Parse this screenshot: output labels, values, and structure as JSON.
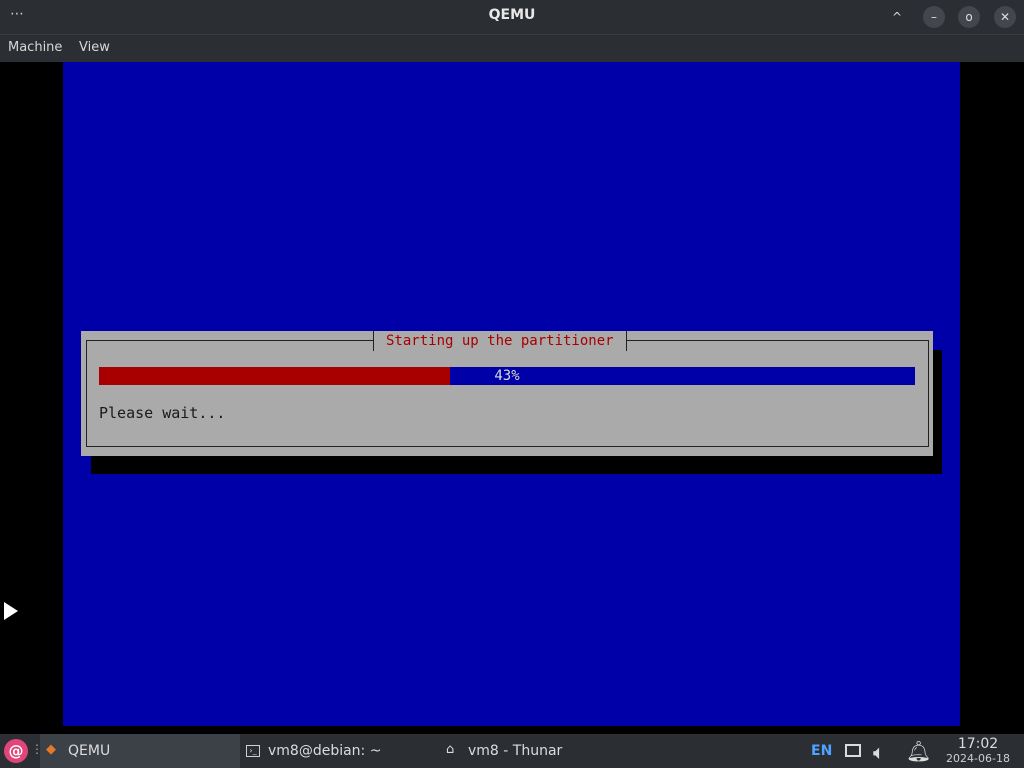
{
  "window": {
    "title": "QEMU",
    "controls": {
      "menu": "⋯",
      "restore_up": "^",
      "minimize": "–",
      "maximize": "o",
      "close": "✕"
    }
  },
  "menubar": {
    "items": [
      "Machine",
      "View"
    ]
  },
  "installer": {
    "dialog_title": "Starting up the partitioner",
    "progress": {
      "percent_value": 43,
      "label": "43%"
    },
    "message": "Please wait...",
    "colors": {
      "background": "#0000a8",
      "dialog": "#aaaaaa",
      "progress_fill": "#a80000",
      "title_text": "#a80000"
    }
  },
  "taskbar": {
    "start_icon": "debian-swirl-icon",
    "tasks": [
      {
        "label": "QEMU",
        "icon": "qemu-icon",
        "active": true
      },
      {
        "label": "vm8@debian: ~",
        "icon": "terminal-icon",
        "active": false
      },
      {
        "label": "vm8 - Thunar",
        "icon": "home-folder-icon",
        "active": false
      }
    ],
    "tray": {
      "keyboard_layout": "EN",
      "network_icon": "network-icon",
      "volume_icon": "volume-icon",
      "notification_icon": "bell-icon"
    },
    "clock": {
      "time": "17:02",
      "date": "2024-06-18"
    }
  }
}
